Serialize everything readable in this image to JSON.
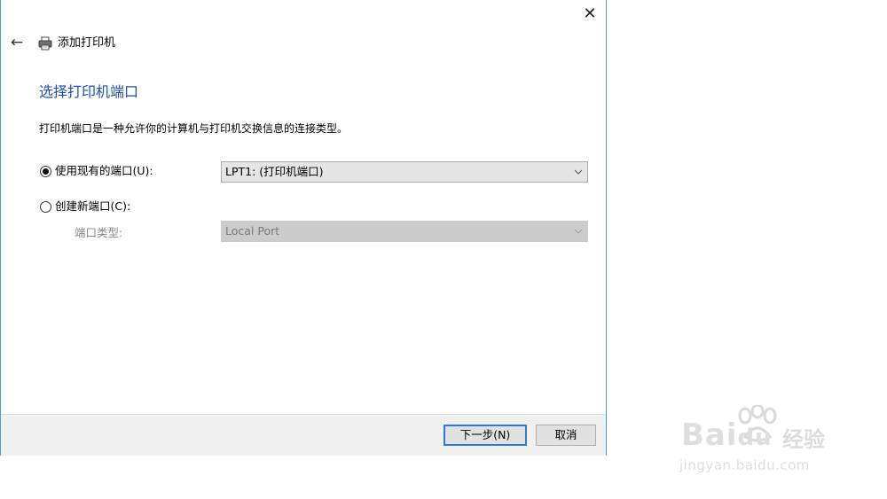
{
  "window": {
    "title": "添加打印机",
    "close_glyph": "✕",
    "back_glyph": "←",
    "border_color": "#4aa0c8"
  },
  "content": {
    "heading": "选择打印机端口",
    "description": "打印机端口是一种允许你的计算机与打印机交换信息的连接类型。",
    "heading_color": "#1f4fa8"
  },
  "options": {
    "existing_port": {
      "label": "使用现有的端口(U):",
      "selected": true,
      "select_value": "LPT1: (打印机端口)"
    },
    "new_port": {
      "label": "创建新端口(C):",
      "selected": false,
      "port_type_label": "端口类型:",
      "select_value": "Local Port",
      "disabled": true
    }
  },
  "buttons": {
    "next": "下一步(N)",
    "cancel": "取消",
    "primary_color": "#2a7ad6"
  },
  "icons": {
    "close": "close-icon",
    "back": "back-arrow-icon",
    "printer": "printer-icon",
    "dropdown": "chevron-down-icon"
  },
  "watermark": {
    "brand": "Bai",
    "brand2": "du",
    "cn": "经验",
    "url": "jingyan.baidu.com"
  }
}
